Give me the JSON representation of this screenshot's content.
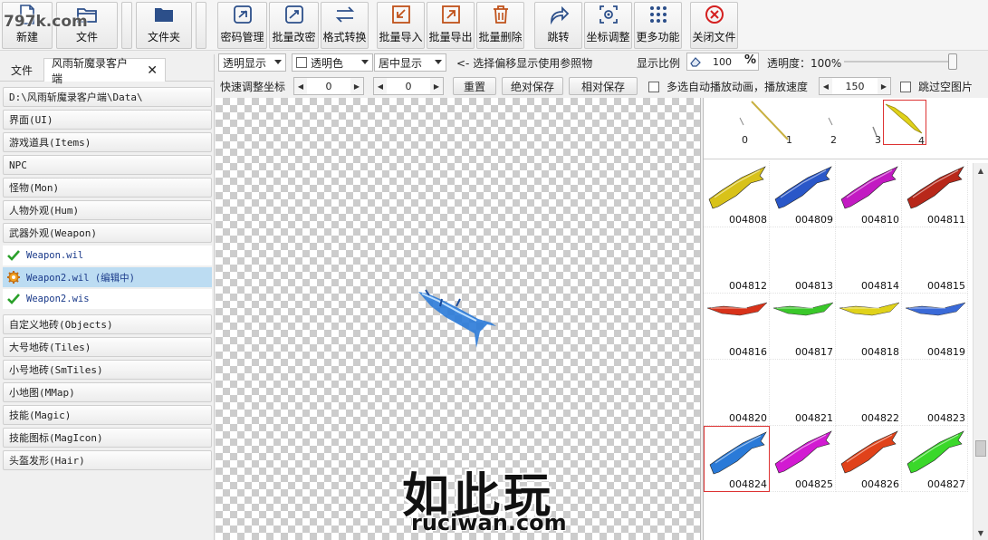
{
  "watermark_top": "797k.com",
  "toolbar": {
    "new_label": "新建",
    "file_label": "文件",
    "folder_label": "文件夹",
    "pwd_manage_label": "密码管理",
    "batch_pwd_label": "批量改密",
    "format_convert_label": "格式转换",
    "batch_import_label": "批量导入",
    "batch_export_label": "批量导出",
    "batch_delete_label": "批量删除",
    "jump_label": "跳转",
    "coord_adjust_label": "坐标调整",
    "more_label": "更多功能",
    "close_file_label": "关闭文件"
  },
  "left": {
    "tab_file": "文件",
    "tab_client": "风雨斩魔录客户端",
    "path": "D:\\风雨斩魔录客户端\\Data\\",
    "items_top": [
      "界面(UI)",
      "游戏道具(Items)",
      "NPC",
      "怪物(Mon)",
      "人物外观(Hum)",
      "武器外观(Weapon)"
    ],
    "files": [
      {
        "name": "Weapon.wil",
        "state": "ok"
      },
      {
        "name": "Weapon2.wil (编辑中)",
        "state": "editing"
      },
      {
        "name": "Weapon2.wis",
        "state": "ok"
      }
    ],
    "items_bottom": [
      "自定义地砖(Objects)",
      "大号地砖(Tiles)",
      "小号地砖(SmTiles)",
      "小地图(MMap)",
      "技能(Magic)",
      "技能图标(MagIcon)",
      "头盔发形(Hair)"
    ]
  },
  "options": {
    "display_mode": "透明显示",
    "transparent_color": "透明色",
    "align_mode": "居中显示",
    "offset_hint": "<- 选择偏移显示使用参照物",
    "scale_label": "显示比例",
    "scale_value": "100",
    "percent": "%",
    "opacity_label": "透明度：100%",
    "opacity": 1.0,
    "quick_adjust_label": "快速调整坐标",
    "x_value": "0",
    "y_value": "0",
    "reset_label": "重置",
    "abs_save_label": "绝对保存",
    "rel_save_label": "相对保存",
    "auto_play_label": "多选自动播放动画，播放速度",
    "speed_value": "150",
    "skip_empty_label": "跳过空图片"
  },
  "frames": [
    "0",
    "1",
    "2",
    "3",
    "4"
  ],
  "cells": [
    {
      "id": "004808",
      "color": "#d8c21a"
    },
    {
      "id": "004809",
      "color": "#2a57c8"
    },
    {
      "id": "004810",
      "color": "#c21ac2"
    },
    {
      "id": "004811",
      "color": "#b8281a"
    },
    {
      "id": "004812",
      "color": ""
    },
    {
      "id": "004813",
      "color": ""
    },
    {
      "id": "004814",
      "color": ""
    },
    {
      "id": "004815",
      "color": ""
    },
    {
      "id": "004816",
      "color": "#d8321a"
    },
    {
      "id": "004817",
      "color": "#3ac82a"
    },
    {
      "id": "004818",
      "color": "#e0d21a"
    },
    {
      "id": "004819",
      "color": "#3a6ad8"
    },
    {
      "id": "004820",
      "color": ""
    },
    {
      "id": "004821",
      "color": ""
    },
    {
      "id": "004822",
      "color": ""
    },
    {
      "id": "004823",
      "color": ""
    },
    {
      "id": "004824",
      "color": "#2a7ad8"
    },
    {
      "id": "004825",
      "color": "#d21ad2"
    },
    {
      "id": "004826",
      "color": "#e0421a"
    },
    {
      "id": "004827",
      "color": "#3ad82a"
    }
  ],
  "watermark": {
    "cn": "如此玩",
    "en": "ruciwan.com"
  }
}
